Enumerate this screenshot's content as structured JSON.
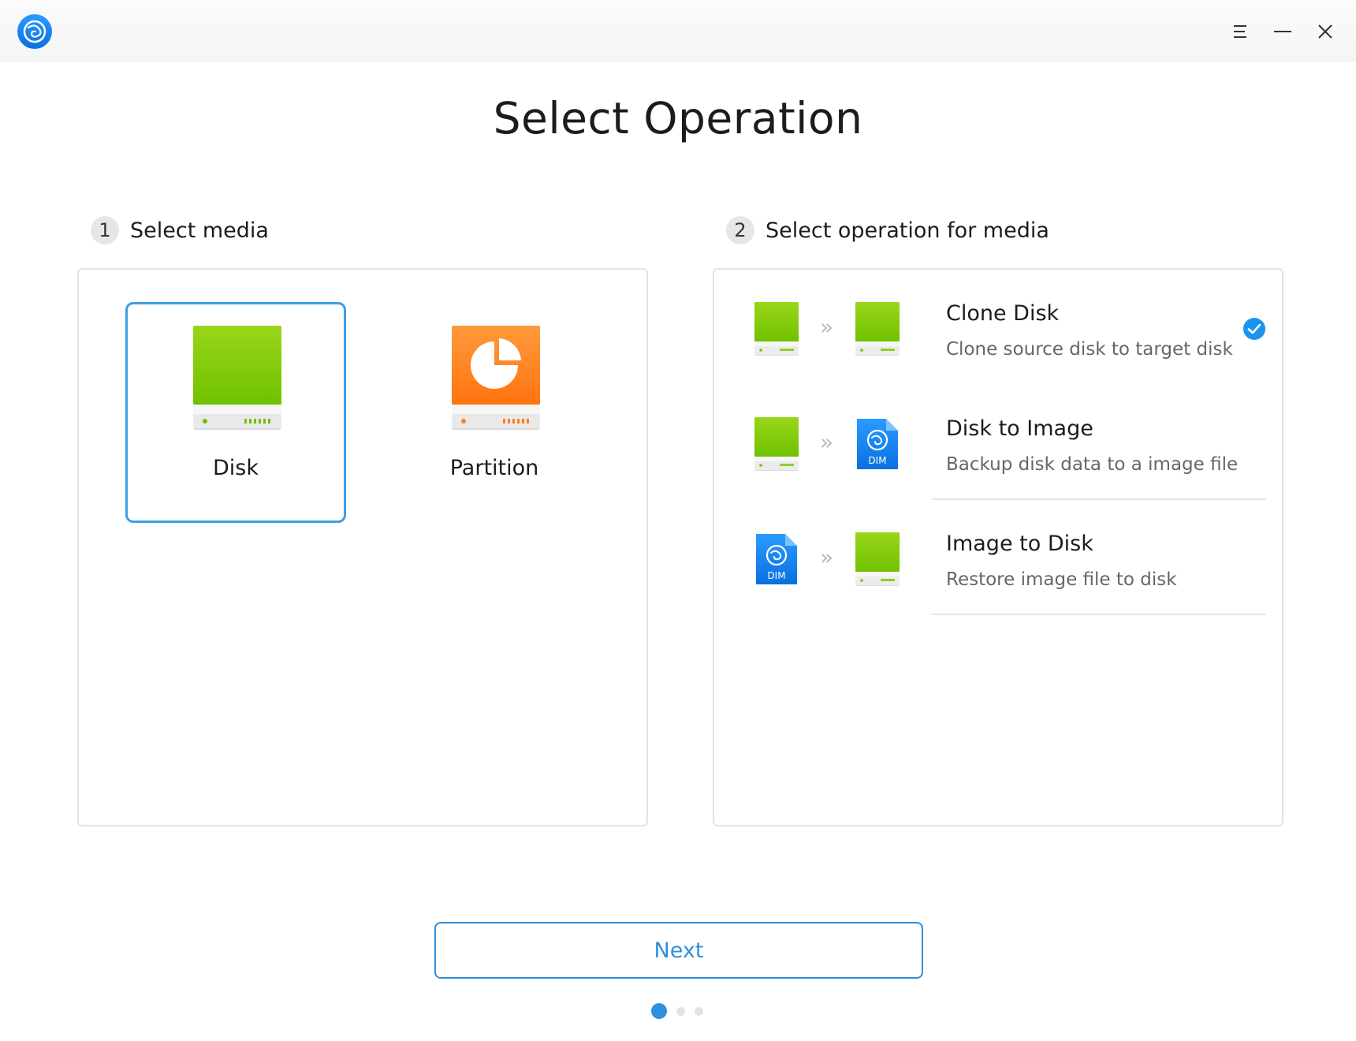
{
  "window": {
    "title_bar": {
      "app_icon": "deepin-clone-icon",
      "buttons": [
        "menu-icon",
        "minimize-icon",
        "close-icon"
      ]
    }
  },
  "page": {
    "title": "Select Operation"
  },
  "step1": {
    "number": "1",
    "label": "Select media",
    "options": [
      {
        "label": "Disk",
        "icon": "disk-icon",
        "selected": true
      },
      {
        "label": "Partition",
        "icon": "partition-icon",
        "selected": false
      }
    ]
  },
  "step2": {
    "number": "2",
    "label": "Select operation for media",
    "operations": [
      {
        "title": "Clone Disk",
        "description": "Clone source disk to target disk",
        "from_icon": "disk-icon",
        "to_icon": "disk-icon",
        "selected": true
      },
      {
        "title": "Disk to Image",
        "description": "Backup disk data to a image file",
        "from_icon": "disk-icon",
        "to_icon": "dim-file-icon",
        "selected": false
      },
      {
        "title": "Image to Disk",
        "description": "Restore image file to disk",
        "from_icon": "dim-file-icon",
        "to_icon": "disk-icon",
        "selected": false
      }
    ],
    "arrow_glyph": "»",
    "dim_label": "DIM"
  },
  "footer": {
    "next_label": "Next",
    "pager": {
      "total": 3,
      "current": 1
    }
  },
  "colors": {
    "accent": "#2e8fdc",
    "selection_border": "#3d9ee6",
    "disk_green": "#7fcd0b",
    "partition_orange": "#ff7f1f",
    "dim_blue": "#1f8cf0"
  }
}
